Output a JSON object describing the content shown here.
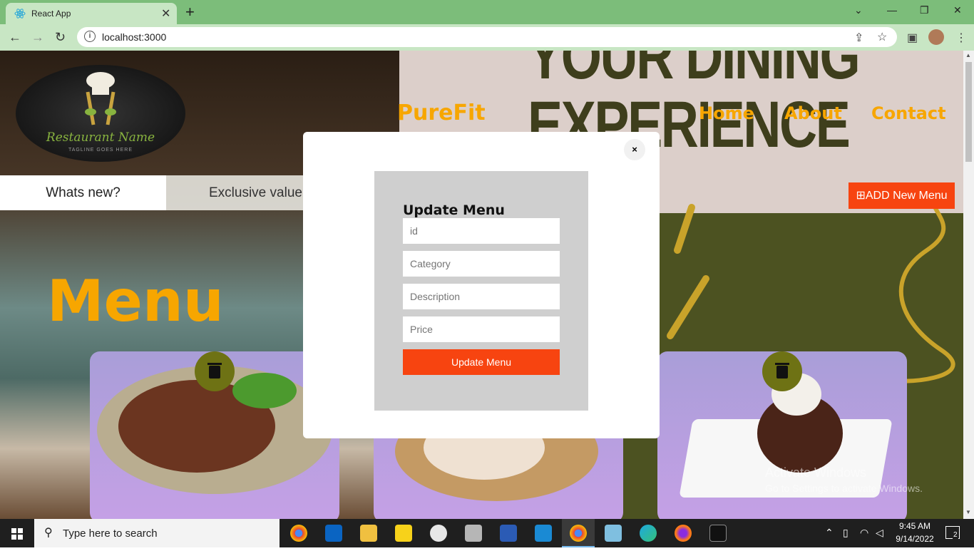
{
  "browser": {
    "tab_title": "React App",
    "tab_close": "✕",
    "new_tab": "+",
    "url": "localhost:3000",
    "controls": {
      "minimize": "—",
      "maximize": "❐",
      "close": "✕",
      "tabs_dropdown": "⌄"
    }
  },
  "site": {
    "logo_name": "Restaurant Name",
    "logo_tagline": "TAGLINE GOES HERE",
    "brand": "PureFit",
    "nav": [
      "Home",
      "About",
      "Contact"
    ],
    "poster_lines": [
      "YOUR DINING",
      "EXPERIENCE"
    ],
    "tabs": [
      "Whats new?",
      "Exclusive value"
    ],
    "add_button": "ADD New Menu",
    "menu_heading": "Menu"
  },
  "modal": {
    "close_label": "×",
    "title": "Update Menu",
    "fields": {
      "id_placeholder": "id",
      "category_placeholder": "Category",
      "description_placeholder": "Description",
      "price_placeholder": "Price"
    },
    "submit_label": "Update Menu"
  },
  "watermark": {
    "line1": "Activate Windows",
    "line2": "Go to Settings to activate Windows."
  },
  "taskbar": {
    "search_placeholder": "Type here to search",
    "time": "9:45 AM",
    "date": "9/14/2022",
    "notification_count": "2"
  },
  "colors": {
    "accent_orange": "#f7a600",
    "button_red": "#f74410",
    "trash_olive": "#6e7214",
    "card_purple": "#c5a0e6"
  }
}
